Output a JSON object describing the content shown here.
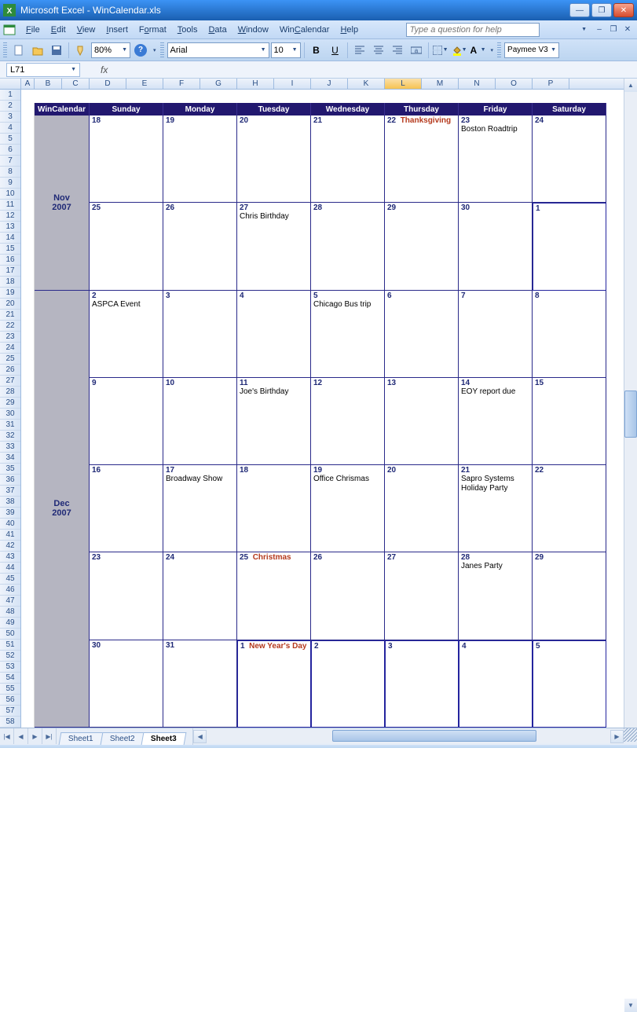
{
  "titlebar": {
    "app": "Microsoft Excel",
    "doc": "WinCalendar.xls"
  },
  "menu": {
    "file": "File",
    "edit": "Edit",
    "view": "View",
    "insert": "Insert",
    "format": "Format",
    "tools": "Tools",
    "data": "Data",
    "window": "Window",
    "wincal": "WinCalendar",
    "help": "Help"
  },
  "help_placeholder": "Type a question for help",
  "toolbar": {
    "zoom": "80%",
    "font": "Arial",
    "size": "10",
    "paymee": "Paymee V3"
  },
  "namebox": "L71",
  "columns": [
    "A",
    "B",
    "C",
    "D",
    "E",
    "F",
    "G",
    "H",
    "I",
    "J",
    "K",
    "L",
    "M",
    "N",
    "O",
    "P"
  ],
  "rows": 58,
  "selected_col": "L",
  "calendar": {
    "brand": "WinCalendar",
    "days": [
      "Sunday",
      "Monday",
      "Tuesday",
      "Wednesday",
      "Thursday",
      "Friday",
      "Saturday"
    ],
    "months": [
      {
        "label": "Nov 2007",
        "weeks": [
          [
            {
              "n": "18"
            },
            {
              "n": "19"
            },
            {
              "n": "20"
            },
            {
              "n": "21"
            },
            {
              "n": "22",
              "holiday": "Thanksgiving"
            },
            {
              "n": "23",
              "event": "Boston Roadtrip"
            },
            {
              "n": "24"
            }
          ],
          [
            {
              "n": "25"
            },
            {
              "n": "26"
            },
            {
              "n": "27",
              "event": "Chris Birthday"
            },
            {
              "n": "28"
            },
            {
              "n": "29"
            },
            {
              "n": "30"
            },
            {
              "n": "1",
              "next": true
            }
          ]
        ]
      },
      {
        "label": "Dec 2007",
        "weeks": [
          [
            {
              "n": "2",
              "event": "ASPCA Event"
            },
            {
              "n": "3"
            },
            {
              "n": "4"
            },
            {
              "n": "5",
              "event": "Chicago Bus trip"
            },
            {
              "n": "6"
            },
            {
              "n": "7"
            },
            {
              "n": "8"
            }
          ],
          [
            {
              "n": "9"
            },
            {
              "n": "10"
            },
            {
              "n": "11",
              "event": "Joe's Birthday"
            },
            {
              "n": "12"
            },
            {
              "n": "13"
            },
            {
              "n": "14",
              "event": "EOY report due"
            },
            {
              "n": "15"
            }
          ],
          [
            {
              "n": "16"
            },
            {
              "n": "17",
              "event": "Broadway Show"
            },
            {
              "n": "18"
            },
            {
              "n": "19",
              "event": "Office Chrismas"
            },
            {
              "n": "20"
            },
            {
              "n": "21",
              "event": "Sapro Systems Holiday Party"
            },
            {
              "n": "22"
            }
          ],
          [
            {
              "n": "23"
            },
            {
              "n": "24"
            },
            {
              "n": "25",
              "holiday": "Christmas"
            },
            {
              "n": "26"
            },
            {
              "n": "27"
            },
            {
              "n": "28",
              "event": "Janes Party"
            },
            {
              "n": "29"
            }
          ],
          [
            {
              "n": "30"
            },
            {
              "n": "31"
            },
            {
              "n": "1",
              "holiday": "New Year's Day",
              "next": true
            },
            {
              "n": "2",
              "next": true
            },
            {
              "n": "3",
              "next": true
            },
            {
              "n": "4",
              "next": true
            },
            {
              "n": "5",
              "next": true
            }
          ]
        ]
      }
    ]
  },
  "tabs": [
    "Sheet1",
    "Sheet2",
    "Sheet3"
  ],
  "active_tab": 2
}
